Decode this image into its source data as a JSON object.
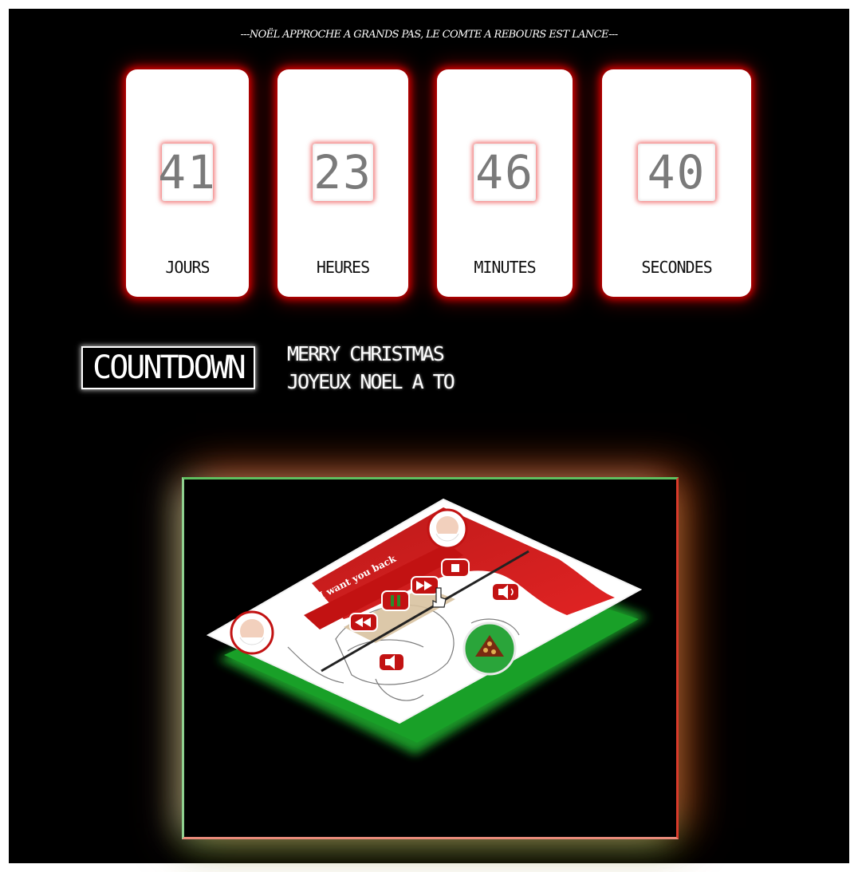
{
  "page": {
    "headline": "---NOËL APPROCHE A GRANDS PAS, LE COMTE A REBOURS EST LANCE---"
  },
  "countdown": {
    "units": [
      {
        "value": "41",
        "label": "JOURS"
      },
      {
        "value": "23",
        "label": "HEURES"
      },
      {
        "value": "46",
        "label": "MINUTES"
      },
      {
        "value": "40",
        "label": "SECONDES"
      }
    ],
    "badge": "COUNTDOWN",
    "ticker_lines": [
      "MERRY CHRISTMAS ",
      "JOYEUX NOEL A TO"
    ]
  },
  "showcase": {
    "player_title": "I want you back",
    "colors": {
      "accent": "#cc1111",
      "base_green": "#1f9e2b",
      "frame_green": "#5fbf5f",
      "frame_red": "#d93a2a"
    },
    "icons": [
      "santa-face-icon",
      "rewind-icon",
      "pause-icon",
      "fast-forward-icon",
      "stop-icon",
      "volume-icon",
      "mute-icon",
      "pizza-plate-icon",
      "hand-cursor-icon"
    ]
  }
}
